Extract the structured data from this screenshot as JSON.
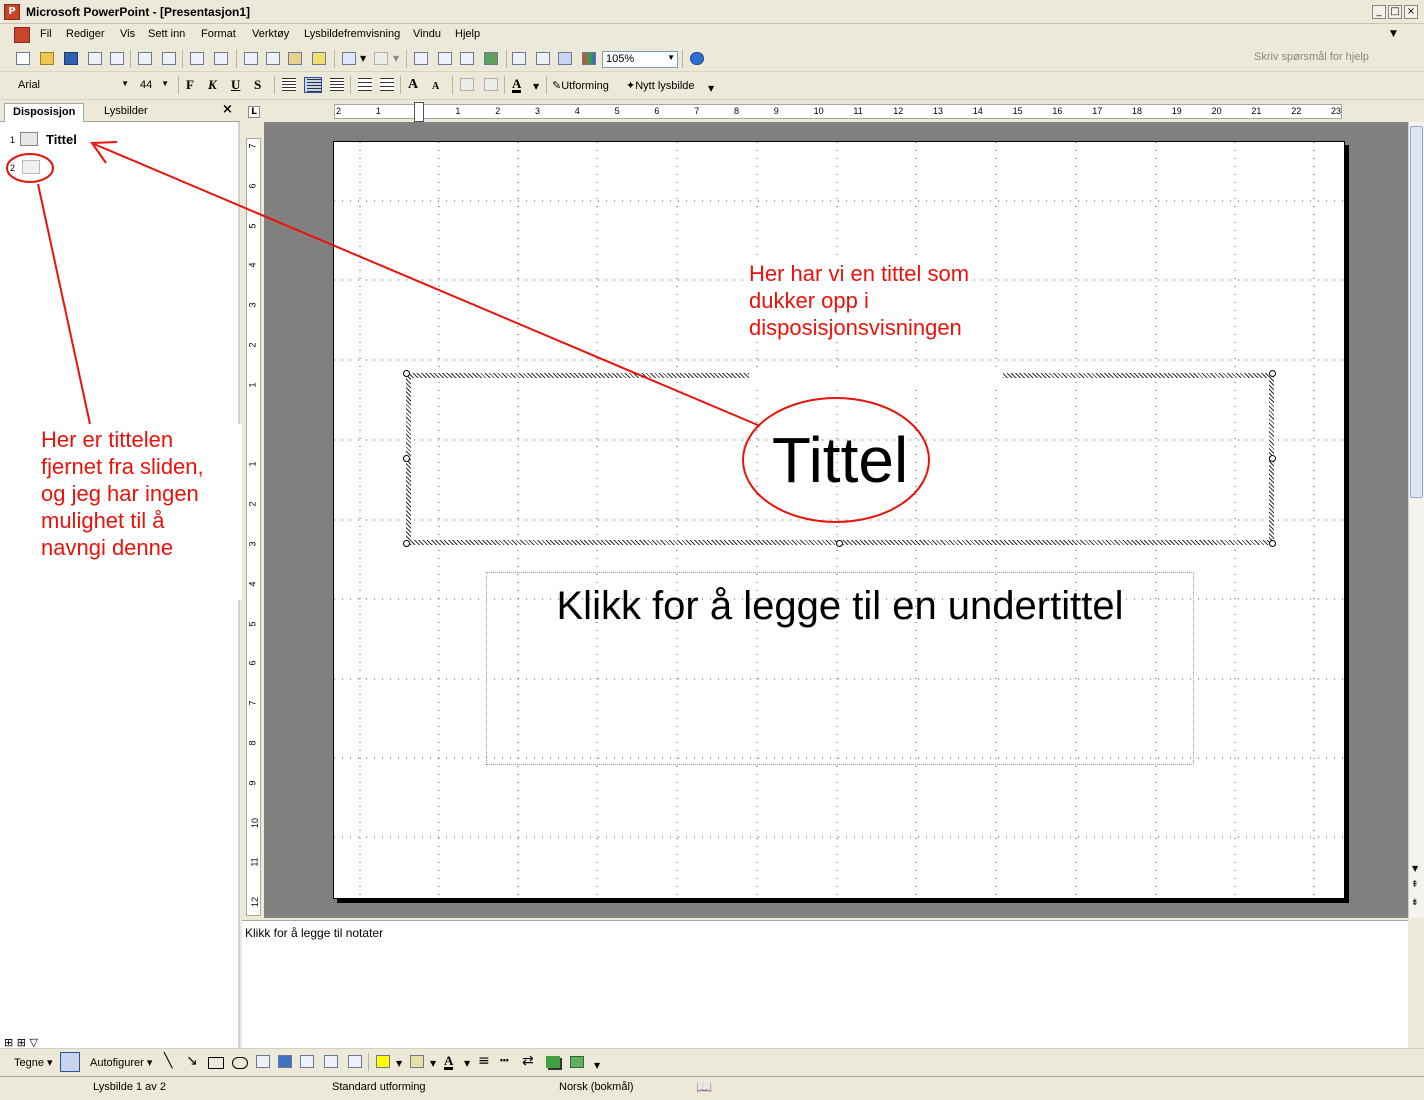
{
  "window": {
    "title": "Microsoft PowerPoint - [Presentasjon1]",
    "app_icon": "powerpoint-icon"
  },
  "menu": {
    "items": [
      "Fil",
      "Rediger",
      "Vis",
      "Sett inn",
      "Format",
      "Verktøy",
      "Lysbildefremvisning",
      "Vindu",
      "Hjelp"
    ],
    "help_placeholder": "Skriv spørsmål for hjelp"
  },
  "toolbar": {
    "zoom": "105%",
    "font": "Arial",
    "font_size": "44",
    "bold": "F",
    "italic": "K",
    "underline": "U",
    "shadow": "S",
    "design_label": "Utforming",
    "new_slide_label": "Nytt lysbilde"
  },
  "left_pane": {
    "tabs": [
      "Disposisjon",
      "Lysbilder"
    ],
    "close": "×",
    "outline": [
      {
        "num": "1",
        "title": "Tittel"
      },
      {
        "num": "2",
        "title": ""
      }
    ]
  },
  "ruler": {
    "h_labels": [
      "2",
      "1",
      "",
      "1",
      "2",
      "3",
      "4",
      "5",
      "6",
      "7",
      "8",
      "9",
      "10",
      "11",
      "12",
      "13",
      "14",
      "15",
      "16",
      "17",
      "18",
      "19",
      "20",
      "21",
      "22",
      "23"
    ],
    "v_labels": [
      "7",
      "6",
      "5",
      "4",
      "3",
      "2",
      "1",
      "",
      "1",
      "2",
      "3",
      "4",
      "5",
      "6",
      "7",
      "8",
      "9",
      "10",
      "11",
      "12"
    ]
  },
  "slide": {
    "title": "Tittel",
    "subtitle_placeholder": "Klikk for å legge til en undertittel"
  },
  "notes": {
    "placeholder": "Klikk for å legge til notater"
  },
  "annotations": {
    "left": "Her er tittelen\nfjernet fra sliden,\nog jeg har ingen\nmulighet til å\nnavngi denne",
    "right": "Her har vi en tittel som\ndukker opp i\ndisposisjonsvisningen",
    "color": "#e8140c"
  },
  "drawing": {
    "draw_label": "Tegne",
    "autoshapes_label": "Autofigurer"
  },
  "status": {
    "slide": "Lysbilde 1 av 2",
    "design": "Standard utforming",
    "language": "Norsk (bokmål)"
  }
}
